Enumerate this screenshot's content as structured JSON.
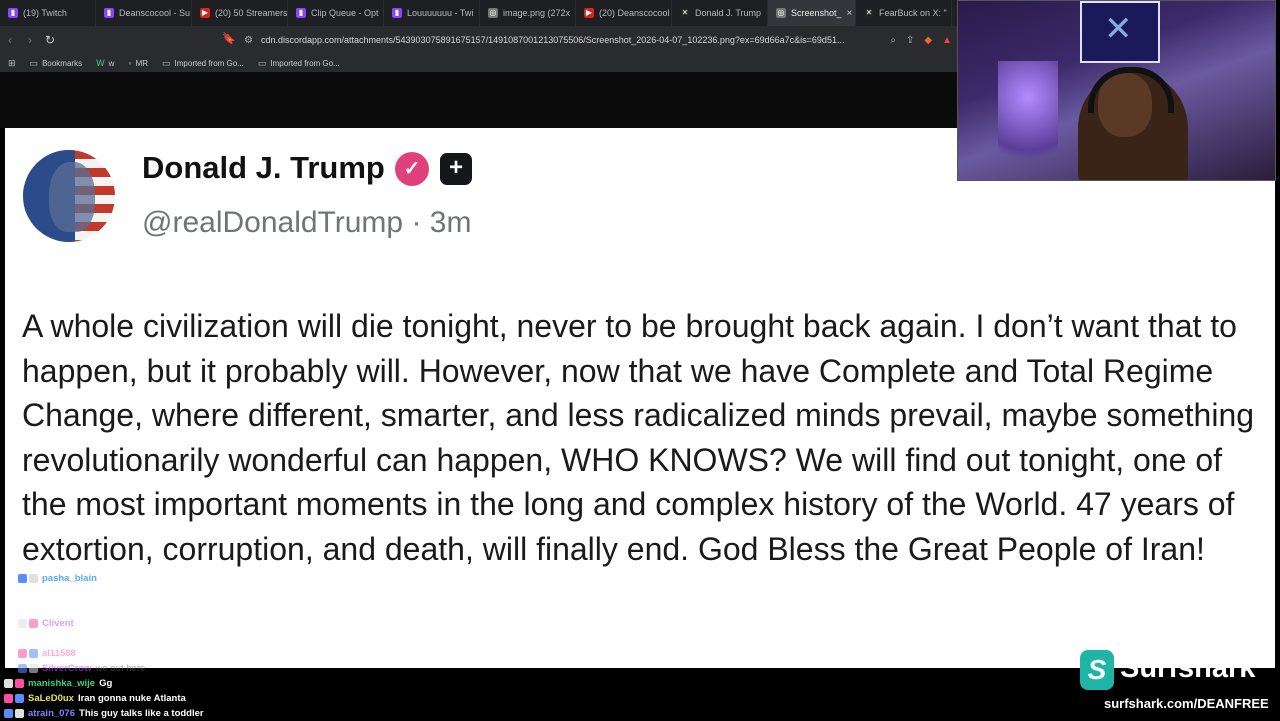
{
  "browser": {
    "tabs": [
      {
        "title": "(19) Twitch",
        "color": "#8a44ff",
        "glyph": "▮"
      },
      {
        "title": "Deanscocool - Su",
        "color": "#8a44ff",
        "glyph": "▮"
      },
      {
        "title": "(20) 50 Streamers",
        "color": "#e02020",
        "glyph": "▶"
      },
      {
        "title": "Clip Queue - Opt",
        "color": "#8a44ff",
        "glyph": "▮"
      },
      {
        "title": "Louuuuuuu - Twi",
        "color": "#8a44ff",
        "glyph": "▮"
      },
      {
        "title": "image.png (272x",
        "color": "#777",
        "glyph": "◎"
      },
      {
        "title": "(20) Deanscocool",
        "color": "#e02020",
        "glyph": "▶"
      },
      {
        "title": "Donald J. Trump",
        "color": "#222",
        "glyph": "✕"
      },
      {
        "title": "Screenshot_",
        "color": "#777",
        "glyph": "◎",
        "active": true
      },
      {
        "title": "FearBuck on X: \"",
        "color": "#222",
        "glyph": "✕"
      }
    ],
    "url": "cdn.discordapp.com/attachments/543903075891675157/1491087001213075506/Screenshot_2026-04-07_102236.png?ex=69d66a7c&is=69d51...",
    "bookmarks": [
      {
        "label": "Bookmarks",
        "icon": "bookmark-folder-icon"
      },
      {
        "label": "w",
        "icon": "w-logo-icon"
      },
      {
        "label": "MR",
        "icon": "mr-icon"
      },
      {
        "label": "Imported from Go...",
        "icon": "folder-icon"
      },
      {
        "label": "Imported from Go...",
        "icon": "folder-icon"
      }
    ]
  },
  "post": {
    "name": "Donald J. Trump",
    "handle": "@realDonaldTrump · 3m",
    "text": "A whole civilization will die tonight, never to be brought back again. I don’t want that to happen, but it probably will. However, now that we have Complete and Total Regime Change, where different, smarter, and less radicalized minds prevail, maybe something revolutionarily wonderful can happen, WHO KNOWS? We will find out tonight, one of the most important moments in the long and complex history of the World. 47 years of extortion, corruption, and death, will finally end. God Bless the Great People of Iran!"
  },
  "chat": [
    {
      "user": "pasha_blain",
      "color": "#5aa8ff",
      "message": "",
      "faded": false
    },
    {
      "user": "Clivent",
      "color": "#c050ff",
      "message": "",
      "faded": true
    },
    {
      "user": "al11588",
      "color": "#ff66cc",
      "message": "",
      "faded": true
    },
    {
      "user": "SilverCrow",
      "color": "#c050ff",
      "message": "we out here",
      "faded": true
    },
    {
      "user": "manishka_wije",
      "color": "#3cd070",
      "message": "Gg",
      "faded": false
    },
    {
      "user": "SaLeD0ux",
      "color": "#e8e05a",
      "message": "Iran gonna nuke Atlanta",
      "faded": false
    },
    {
      "user": "atrain_076",
      "color": "#8a7cff",
      "message": "This guy talks like a toddler",
      "faded": false
    }
  ],
  "sponsor": {
    "brand": "Surfshark",
    "url": "surfshark.com/DEANFREE",
    "color": "#1fb5a6"
  }
}
